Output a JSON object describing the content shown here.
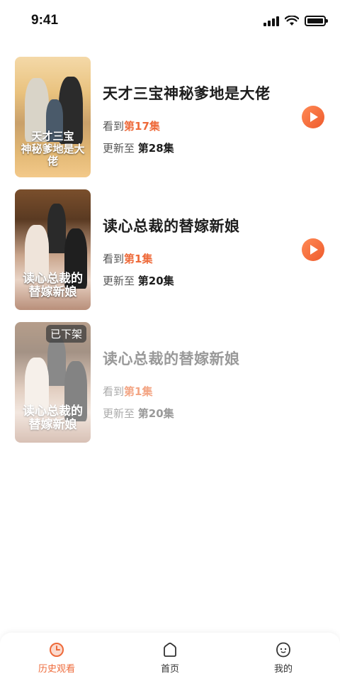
{
  "status_bar": {
    "time": "9:41"
  },
  "history": [
    {
      "title": "天才三宝神秘爹地是大佬",
      "watched_prefix": "看到",
      "watched_ep": "第17集",
      "updated_prefix": "更新至",
      "updated_ep": "第28集",
      "poster_text": "天才三宝\n神秘爹地是大佬",
      "offline": false
    },
    {
      "title": "读心总裁的替嫁新娘",
      "watched_prefix": "看到",
      "watched_ep": "第1集",
      "updated_prefix": "更新至",
      "updated_ep": "第20集",
      "poster_text": "读心总裁的\n替嫁新娘",
      "offline": false
    },
    {
      "title": "读心总裁的替嫁新娘",
      "watched_prefix": "看到",
      "watched_ep": "第1集",
      "updated_prefix": "更新至",
      "updated_ep": "第20集",
      "poster_text": "读心总裁的\n替嫁新娘",
      "offline": true,
      "badge": "已下架"
    }
  ],
  "tabbar": {
    "tabs": [
      {
        "label": "历史观看",
        "icon": "clock-icon",
        "active": true
      },
      {
        "label": "首页",
        "icon": "home-icon",
        "active": false
      },
      {
        "label": "我的",
        "icon": "profile-icon",
        "active": false
      }
    ]
  },
  "colors": {
    "accent": "#ee6a3a",
    "text": "#1d1d1d",
    "muted": "#555555"
  }
}
